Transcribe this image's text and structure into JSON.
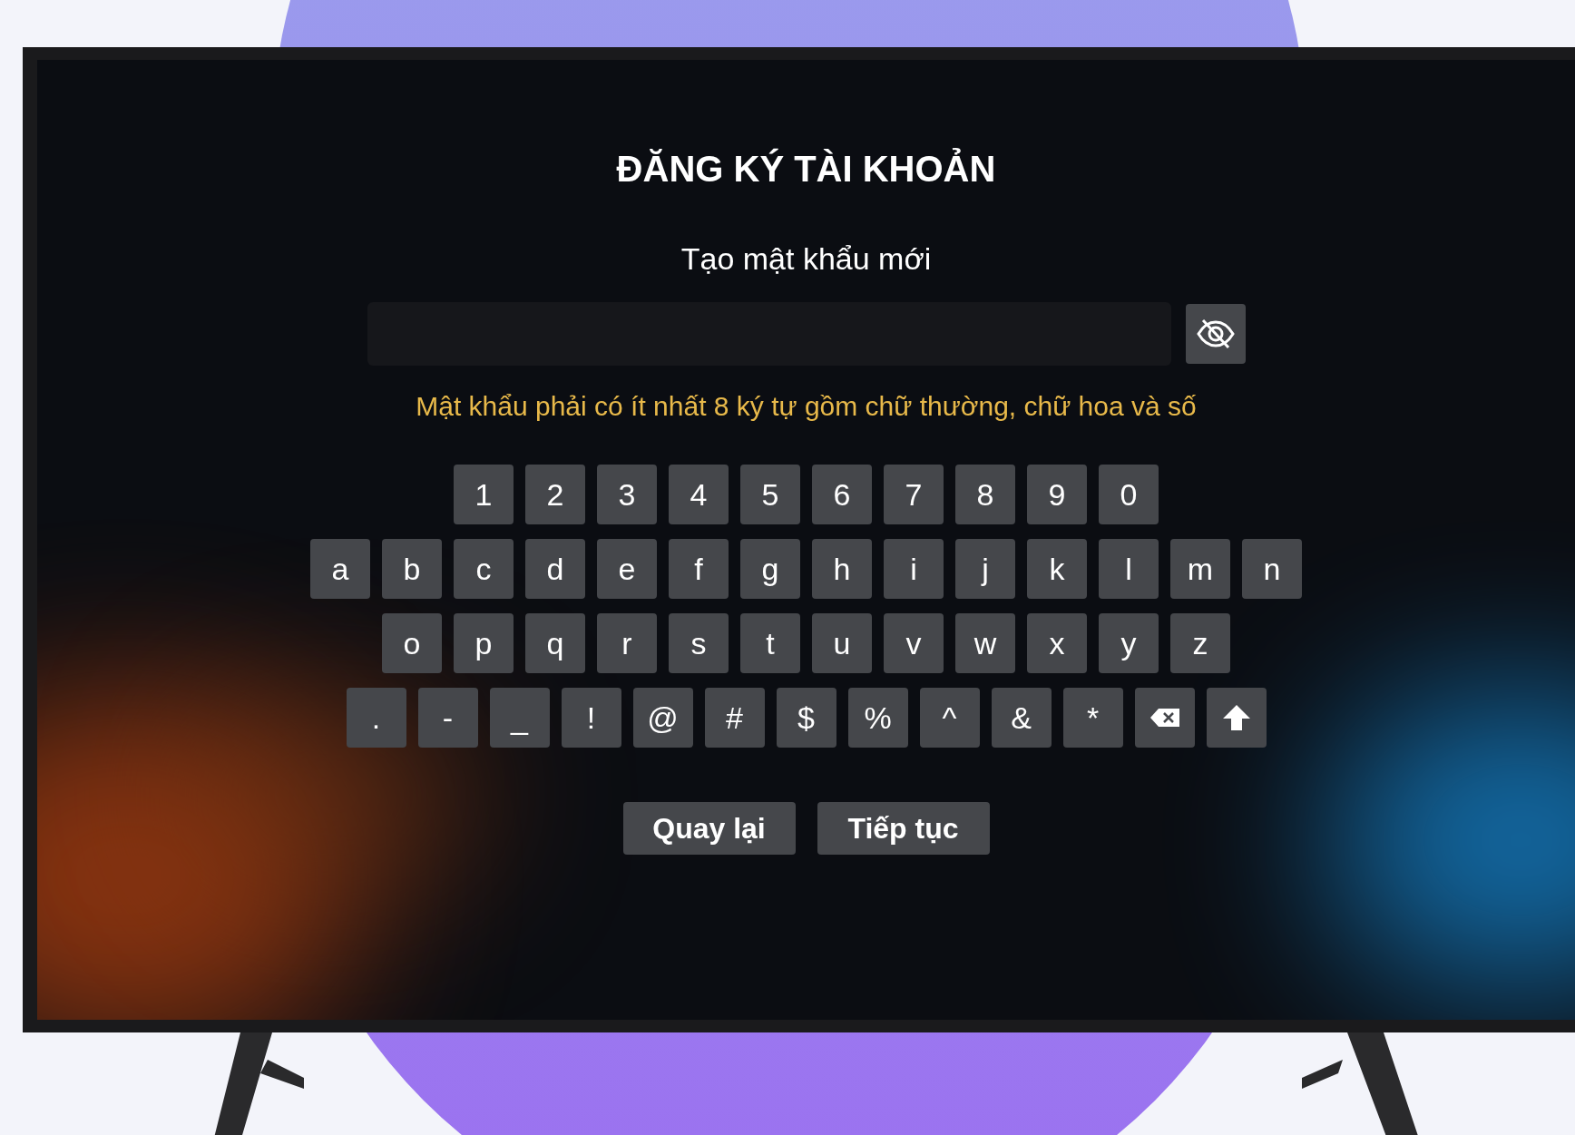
{
  "screen": {
    "title": "ĐĂNG KÝ TÀI KHOẢN",
    "field_label": "Tạo mật khẩu mới",
    "password_visible": false,
    "hint": "Mật khẩu phải có ít nhất 8 ký tự gồm chữ thường, chữ hoa và số"
  },
  "keyboard": {
    "rows": [
      {
        "keys": [
          {
            "kind": "char",
            "label": "1"
          },
          {
            "kind": "char",
            "label": "2"
          },
          {
            "kind": "char",
            "label": "3"
          },
          {
            "kind": "char",
            "label": "4"
          },
          {
            "kind": "char",
            "label": "5"
          },
          {
            "kind": "char",
            "label": "6"
          },
          {
            "kind": "char",
            "label": "7"
          },
          {
            "kind": "char",
            "label": "8"
          },
          {
            "kind": "char",
            "label": "9"
          },
          {
            "kind": "char",
            "label": "0"
          }
        ]
      },
      {
        "keys": [
          {
            "kind": "char",
            "label": "a"
          },
          {
            "kind": "char",
            "label": "b"
          },
          {
            "kind": "char",
            "label": "c"
          },
          {
            "kind": "char",
            "label": "d"
          },
          {
            "kind": "char",
            "label": "e"
          },
          {
            "kind": "char",
            "label": "f"
          },
          {
            "kind": "char",
            "label": "g"
          },
          {
            "kind": "char",
            "label": "h"
          },
          {
            "kind": "char",
            "label": "i"
          },
          {
            "kind": "char",
            "label": "j"
          },
          {
            "kind": "char",
            "label": "k"
          },
          {
            "kind": "char",
            "label": "l"
          },
          {
            "kind": "char",
            "label": "m"
          },
          {
            "kind": "char",
            "label": "n"
          }
        ]
      },
      {
        "keys": [
          {
            "kind": "char",
            "label": "o"
          },
          {
            "kind": "char",
            "label": "p"
          },
          {
            "kind": "char",
            "label": "q"
          },
          {
            "kind": "char",
            "label": "r"
          },
          {
            "kind": "char",
            "label": "s"
          },
          {
            "kind": "char",
            "label": "t"
          },
          {
            "kind": "char",
            "label": "u"
          },
          {
            "kind": "char",
            "label": "v"
          },
          {
            "kind": "char",
            "label": "w"
          },
          {
            "kind": "char",
            "label": "x"
          },
          {
            "kind": "char",
            "label": "y"
          },
          {
            "kind": "char",
            "label": "z"
          }
        ]
      },
      {
        "keys": [
          {
            "kind": "char",
            "label": "."
          },
          {
            "kind": "char",
            "label": "-"
          },
          {
            "kind": "char",
            "label": "_"
          },
          {
            "kind": "char",
            "label": "!"
          },
          {
            "kind": "char",
            "label": "@"
          },
          {
            "kind": "char",
            "label": "#"
          },
          {
            "kind": "char",
            "label": "$"
          },
          {
            "kind": "char",
            "label": "%"
          },
          {
            "kind": "char",
            "label": "^"
          },
          {
            "kind": "char",
            "label": "&"
          },
          {
            "kind": "char",
            "label": "*"
          },
          {
            "kind": "backspace"
          },
          {
            "kind": "shift"
          }
        ]
      }
    ]
  },
  "buttons": [
    "Quay lại",
    "Tiếp tục"
  ]
}
